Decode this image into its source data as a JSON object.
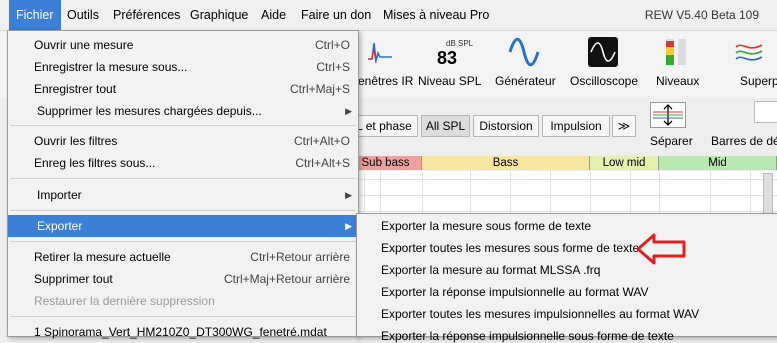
{
  "menubar": {
    "items": [
      "Fichier",
      "Outils",
      "Préférences",
      "Graphique",
      "Aide",
      "Faire un don",
      "Mises à niveau Pro"
    ],
    "version": "REW V5.40 Beta 109"
  },
  "toolbar": {
    "ir": "enêtres IR",
    "spl_small": "dB SPL",
    "spl_value": "83",
    "spl_label": "Niveau SPL",
    "generator": "Générateur",
    "oscilloscope": "Oscilloscope",
    "levels": "Niveaux",
    "superposition": "Superpositi"
  },
  "graph_tabs": [
    "L et phase",
    "All SPL",
    "Distorsion",
    "Impulsion",
    "≫"
  ],
  "separate_label": "Séparer",
  "bars_label": "Barres de dé",
  "bands": [
    "Sub bass",
    "Bass",
    "Low mid",
    "Mid"
  ],
  "file_menu": {
    "items": [
      {
        "label": "Ouvrir une mesure",
        "shortcut": "Ctrl+O"
      },
      {
        "label": "Enregistrer la mesure sous...",
        "shortcut": "Ctrl+S"
      },
      {
        "label": "Enregistrer tout",
        "shortcut": "Ctrl+Maj+S"
      },
      {
        "label": "Supprimer les mesures chargées depuis...",
        "shortcut": ""
      },
      {
        "label": "Ouvrir les filtres",
        "shortcut": "Ctrl+Alt+O"
      },
      {
        "label": "Enreg les filtres sous...",
        "shortcut": "Ctrl+Alt+S"
      },
      {
        "label": "Importer",
        "shortcut": ""
      },
      {
        "label": "Exporter",
        "shortcut": ""
      },
      {
        "label": "Retirer la mesure actuelle",
        "shortcut": "Ctrl+Retour arrière"
      },
      {
        "label": "Supprimer tout",
        "shortcut": "Ctrl+Maj+Retour arrière"
      },
      {
        "label": "Restaurer la dernière suppression",
        "shortcut": ""
      },
      {
        "label": "1 Spinorama_Vert_HM210Z0_DT300WG_fenetré.mdat",
        "shortcut": ""
      }
    ]
  },
  "export_submenu": [
    "Exporter la mesure sous forme de texte",
    "Exporter toutes les mesures sous forme de texte",
    "Exporter la mesure au format MLSSA .frq",
    "Exporter la réponse impulsionnelle au format WAV",
    "Exporter toutes les mesures impulsionnelles au format WAV",
    "Exporter la réponse impulsionnelle sous forme de texte"
  ],
  "colors": {
    "highlight": "#3b7fd6",
    "annotation_arrow": "#e02020"
  }
}
